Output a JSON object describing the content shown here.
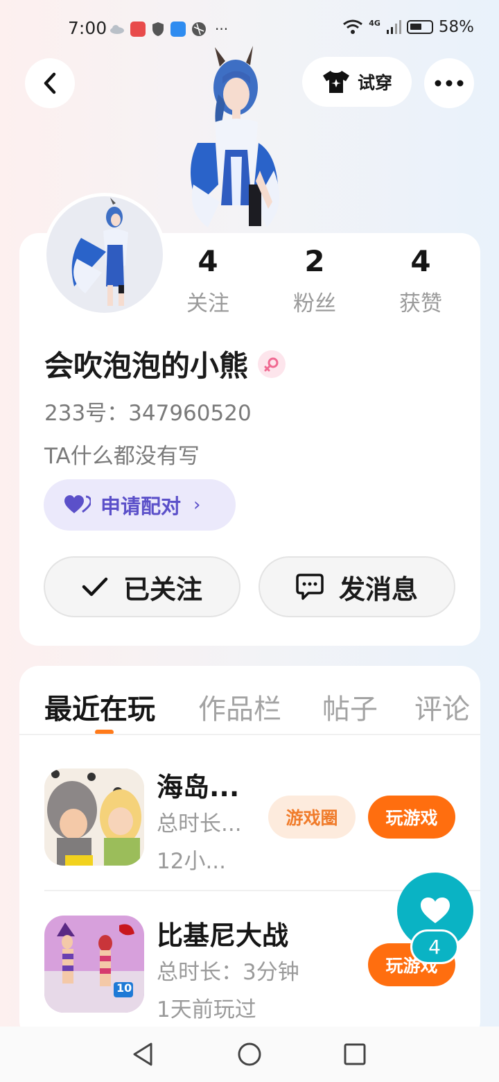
{
  "status_bar": {
    "time": "7:00",
    "network": "4G",
    "battery": "58%",
    "overflow": "···"
  },
  "header": {
    "back_icon": "chevron-left-icon",
    "tryon_label": "试穿",
    "tryon_icon": "shirt-icon",
    "more_icon": "more-dots-icon"
  },
  "profile": {
    "stats": [
      {
        "value": "4",
        "label": "关注"
      },
      {
        "value": "2",
        "label": "粉丝"
      },
      {
        "value": "4",
        "label": "获赞"
      }
    ],
    "username": "会吹泡泡的小熊",
    "gender_icon": "female-icon",
    "user_id": "233号：347960520",
    "bio": "TA什么都没有写",
    "pair_label": "申请配对",
    "pair_chevron": "›",
    "follow_label": "已关注",
    "message_label": "发消息",
    "colors": {
      "accent": "#ff6e0f",
      "pair": "#5b50c9",
      "fab": "#0ab3c4"
    }
  },
  "tabs": [
    "最近在玩",
    "作品栏",
    "帖子",
    "评论"
  ],
  "games": [
    {
      "name": "海岛...",
      "duration": "总时长...",
      "last_played": "12小...",
      "circle_label": "游戏圈",
      "play_label": "玩游戏"
    },
    {
      "name": "比基尼大战",
      "duration": "总时长：3分钟",
      "last_played": "1天前玩过",
      "badge": "10",
      "play_label": "玩游戏"
    }
  ],
  "like_fab": {
    "count": "4"
  },
  "nav": [
    "back-triangle",
    "home-circle",
    "recents-square"
  ]
}
